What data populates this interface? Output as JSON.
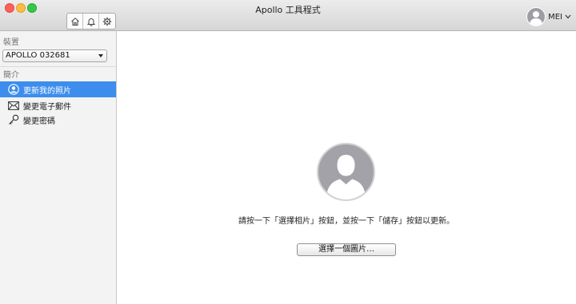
{
  "window": {
    "title": "Apollo 工具程式"
  },
  "toolbar": {
    "icons": [
      "home-icon",
      "bell-icon",
      "gear-icon"
    ]
  },
  "user": {
    "name": "MEI"
  },
  "sidebar": {
    "device_label": "裝置",
    "device_selected": "APOLLO 032681",
    "profile_label": "簡介",
    "items": [
      {
        "label": "更新我的照片",
        "icon": "user-circle-icon",
        "active": true
      },
      {
        "label": "變更電子郵件",
        "icon": "envelope-icon",
        "active": false
      },
      {
        "label": "變更密碼",
        "icon": "key-icon",
        "active": false
      }
    ]
  },
  "main": {
    "instruction": "請按一下「選擇相片」按鈕，並按一下「儲存」按鈕以更新。",
    "choose_button": "選擇一個圖片…"
  },
  "colors": {
    "accent": "#3d8ded",
    "avatar_gray": "#a3a2a8"
  }
}
